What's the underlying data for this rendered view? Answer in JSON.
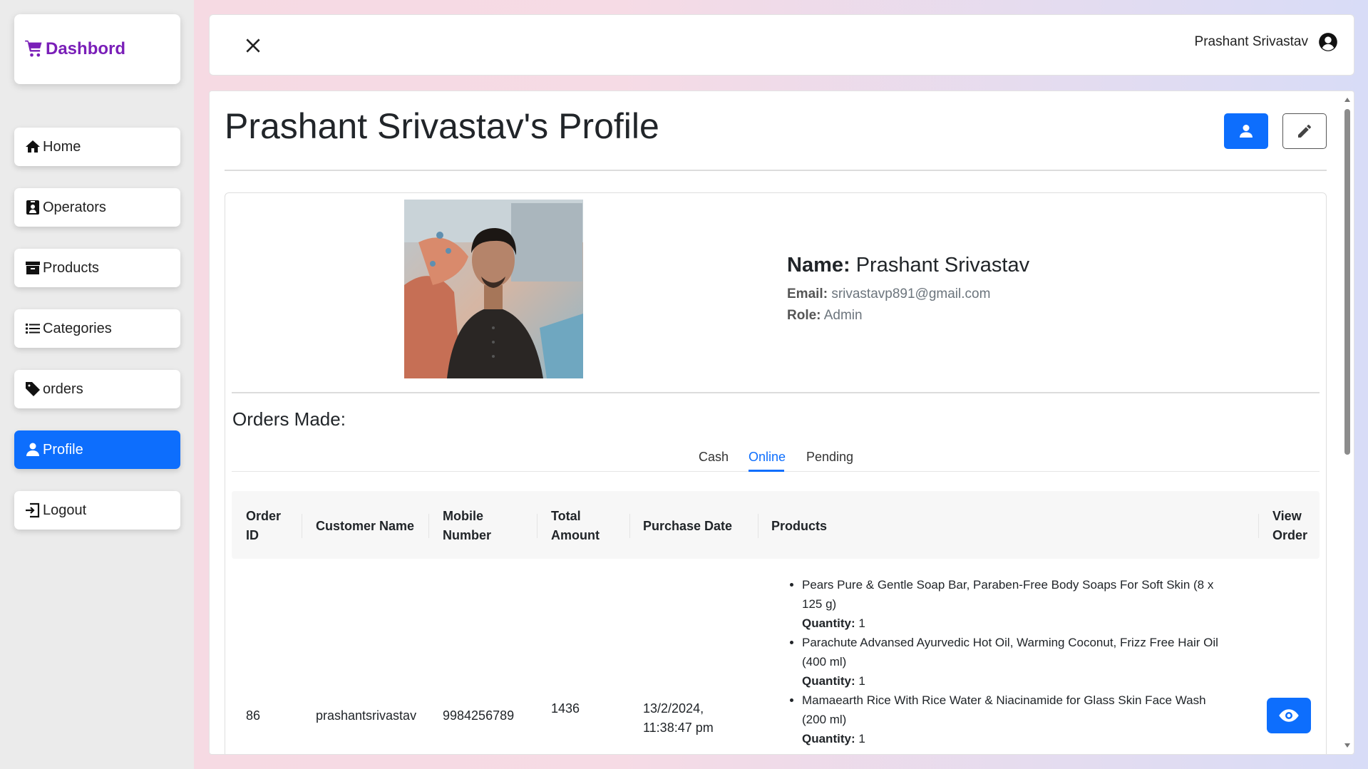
{
  "brand": {
    "title": "Dashbord",
    "color": "#7a1fb8"
  },
  "sidebar": {
    "items": [
      {
        "label": "Home",
        "icon": "home-icon",
        "active": false
      },
      {
        "label": "Operators",
        "icon": "id-badge-icon",
        "active": false
      },
      {
        "label": "Products",
        "icon": "archive-box-icon",
        "active": false
      },
      {
        "label": "Categories",
        "icon": "list-icon",
        "active": false
      },
      {
        "label": "orders",
        "icon": "tag-icon",
        "active": false
      },
      {
        "label": "Profile",
        "icon": "user-icon",
        "active": true
      },
      {
        "label": "Logout",
        "icon": "logout-icon",
        "active": false
      }
    ]
  },
  "topbar": {
    "user_name": "Prashant Srivastav",
    "close_icon": "close-icon",
    "avatar_icon": "user-circle-icon"
  },
  "profile": {
    "page_title": "Prashant Srivastav's Profile",
    "name_label": "Name:",
    "name": "Prashant Srivastav",
    "email_label": "Email:",
    "email": "srivastavp891@gmail.com",
    "role_label": "Role:",
    "role": "Admin"
  },
  "orders": {
    "title": "Orders Made:",
    "tabs": [
      {
        "label": "Cash",
        "active": false
      },
      {
        "label": "Online",
        "active": true
      },
      {
        "label": "Pending",
        "active": false
      }
    ],
    "columns": [
      "Order ID",
      "Customer Name",
      "Mobile Number",
      "Total Amount",
      "Purchase Date",
      "Products",
      "View Order"
    ],
    "rows": [
      {
        "order_id": "86",
        "customer_name": "prashantsrivastav",
        "mobile": "9984256789",
        "total": "1436",
        "purchase_date": "13/2/2024, 11:38:47 pm",
        "products": [
          {
            "name": "Pears Pure & Gentle Soap Bar, Paraben-Free Body Soaps For Soft Skin (8 x 125 g)",
            "qty_label": "Quantity:",
            "qty": "1"
          },
          {
            "name": "Parachute Advansed Ayurvedic Hot Oil, Warming Coconut, Frizz Free Hair Oil (400 ml)",
            "qty_label": "Quantity:",
            "qty": "1"
          },
          {
            "name": "Mamaearth Rice With Rice Water & Niacinamide for Glass Skin Face Wash (200 ml)",
            "qty_label": "Quantity:",
            "qty": "1"
          }
        ]
      }
    ]
  },
  "colors": {
    "primary": "#0d6efd",
    "sidebar_bg": "#ebebeb"
  }
}
